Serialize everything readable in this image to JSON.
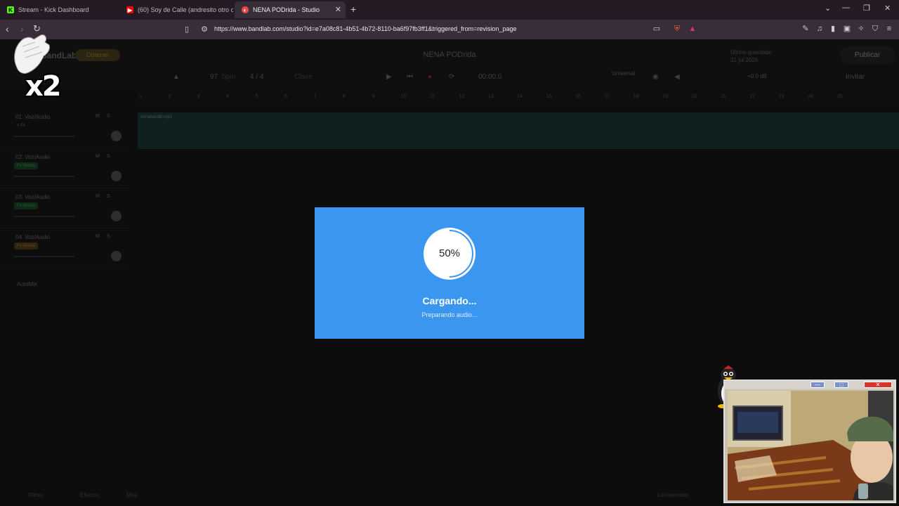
{
  "browser": {
    "tabs": [
      {
        "title": "Stream - Kick Dashboard",
        "icon": "kick-icon"
      },
      {
        "title": "(60) Soy de Calle (andresito otro c",
        "icon": "youtube-icon"
      },
      {
        "title": "NENA PODrida - Studio",
        "icon": "bandlab-icon",
        "active": true
      }
    ],
    "new_tab": "+",
    "url": "https://www.bandlab.com/studio?id=e7a08c81-4b51-4b72-8110-ba6f97fb3ff1&triggered_from=revision_page"
  },
  "studio": {
    "logo": "BandLab",
    "obtener_label": "Obtener",
    "project_title": "NENA PODrida",
    "saved_line1": "Último guardado",
    "saved_line2": "31 jul 2026",
    "publish_label": "Publicar",
    "invite_label": "Invitar",
    "transport": {
      "bpm": "97",
      "bpm_unit": "bpm",
      "time_sig": "4 / 4",
      "key": "Clave",
      "time": "00:00.0",
      "tuner": "Universal",
      "volume": "+0.0 dB"
    },
    "ruler": [
      "1",
      "2",
      "3",
      "4",
      "5",
      "6",
      "7",
      "8",
      "9",
      "10",
      "11",
      "12",
      "13",
      "14",
      "15",
      "16",
      "17",
      "18",
      "19",
      "20",
      "21",
      "22",
      "23",
      "24",
      "25"
    ],
    "tracks": [
      {
        "name": "01. Voz/Audio",
        "fx": "+ Fx"
      },
      {
        "name": "02. Voz/Audio",
        "fx": "Fx Vocals"
      },
      {
        "name": "03. Voz/Audio",
        "fx": "Fx Vocals"
      },
      {
        "name": "04. Voz/Audio",
        "fx": "Fx Vocals"
      }
    ],
    "clip_label": "nenabandlb.mp3",
    "automix": "AutoMix",
    "bottom": {
      "left1": "Ritmo",
      "left2": "Efectos",
      "left3": "Más",
      "right1": "Letras/notas"
    }
  },
  "loading": {
    "percent_label": "50%",
    "progress": 0.5,
    "title": "Cargando...",
    "subtitle": "Preparando audio..."
  },
  "overlay": {
    "multiplier": "x2",
    "webcam_buttons": [
      "—",
      "□",
      "✕"
    ]
  },
  "colors": {
    "modal_bg": "#3a96ee",
    "clip": "#1a4d48",
    "publish": "#2a2a2a"
  }
}
